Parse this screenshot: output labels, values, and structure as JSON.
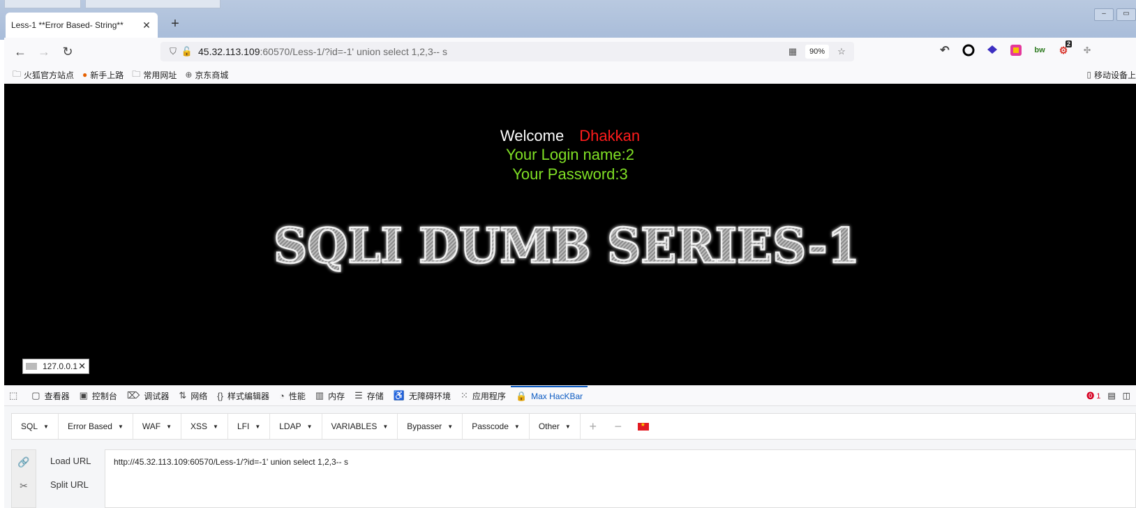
{
  "browser": {
    "tab_title": "Less-1 **Error Based- String**",
    "url_host": "45.32.113.109",
    "url_rest": ":60570/Less-1/?id=-1' union select 1,2,3-- s",
    "zoom": "90%",
    "extension_badge": "2"
  },
  "bookmarks": {
    "items": [
      {
        "label": "火狐官方站点",
        "icon": "folder-icon"
      },
      {
        "label": "新手上路",
        "icon": "firefox-icon"
      },
      {
        "label": "常用网址",
        "icon": "folder-icon"
      },
      {
        "label": "京东商城",
        "icon": "globe-icon"
      }
    ],
    "mobile": "移动设备上"
  },
  "page": {
    "welcome": "Welcome",
    "name": "Dhakkan",
    "login_line": "Your Login name:2",
    "password_line": "Your Password:3",
    "banner": "SQLI DUMB SERIES-1",
    "ip_address": "127.0.0.1"
  },
  "devtools": {
    "tabs": [
      {
        "label": "查看器",
        "icon": "inspector-icon"
      },
      {
        "label": "控制台",
        "icon": "console-icon"
      },
      {
        "label": "调试器",
        "icon": "debugger-icon"
      },
      {
        "label": "网络",
        "icon": "network-icon"
      },
      {
        "label": "样式编辑器",
        "icon": "style-editor-icon"
      },
      {
        "label": "性能",
        "icon": "performance-icon"
      },
      {
        "label": "内存",
        "icon": "memory-icon"
      },
      {
        "label": "存储",
        "icon": "storage-icon"
      },
      {
        "label": "无障碍环境",
        "icon": "accessibility-icon"
      },
      {
        "label": "应用程序",
        "icon": "application-icon"
      },
      {
        "label": "Max HacKBar",
        "icon": "hackbar-icon"
      }
    ],
    "error_count": "1"
  },
  "hackbar": {
    "menus": [
      "SQL",
      "Error Based",
      "WAF",
      "XSS",
      "LFI",
      "LDAP",
      "VARIABLES",
      "Bypasser",
      "Passcode",
      "Other"
    ],
    "load_url_label": "Load URL",
    "split_url_label": "Split URL",
    "url_value": "http://45.32.113.109:60570/Less-1/?id=-1' union select 1,2,3-- s"
  },
  "colors": {
    "accent": "#0b5ac2",
    "welcome_name": "#ff1c1c",
    "info_text": "#80e025",
    "page_bg": "#000000"
  }
}
